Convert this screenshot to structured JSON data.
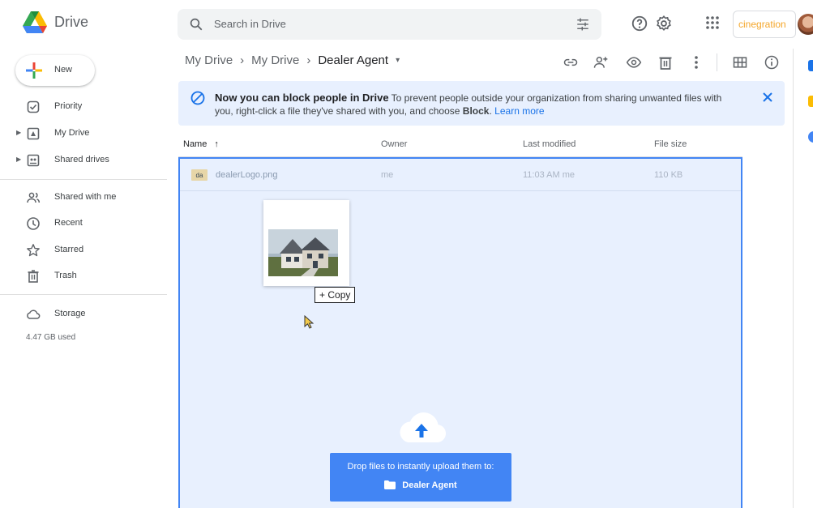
{
  "app": {
    "name": "Drive"
  },
  "search": {
    "placeholder": "Search in Drive"
  },
  "header": {
    "brand": "cinegration"
  },
  "sidebar": {
    "new_label": "New",
    "items": [
      {
        "label": "Priority",
        "icon": "priority-icon"
      },
      {
        "label": "My Drive",
        "icon": "my-drive-icon"
      },
      {
        "label": "Shared drives",
        "icon": "shared-drives-icon"
      },
      {
        "label": "Shared with me",
        "icon": "shared-with-me-icon"
      },
      {
        "label": "Recent",
        "icon": "clock-icon"
      },
      {
        "label": "Starred",
        "icon": "star-icon"
      },
      {
        "label": "Trash",
        "icon": "trash-icon"
      },
      {
        "label": "Storage",
        "icon": "cloud-icon"
      }
    ],
    "storage_used": "4.47 GB used"
  },
  "breadcrumb": {
    "items": [
      "My Drive",
      "My Drive",
      "Dealer Agent"
    ]
  },
  "banner": {
    "heading": "Now you can block people in Drive",
    "text1": "To prevent people outside your organization from sharing unwanted files with you, right-click a file they've shared with you, and choose",
    "bold": "Block",
    "text2": ".",
    "link": "Learn more"
  },
  "columns": {
    "name": "Name",
    "owner": "Owner",
    "modified": "Last modified",
    "size": "File size"
  },
  "files": [
    {
      "name": "dealerLogo.png",
      "owner": "me",
      "modified": "11:03 AM me",
      "size": "110 KB"
    }
  ],
  "drag": {
    "copy_label": "Copy"
  },
  "upload": {
    "line1": "Drop files to instantly upload them to:",
    "folder": "Dealer Agent"
  },
  "colors": {
    "accent": "#1a73e8",
    "drop_bg": "#e8f0fe",
    "drop_border": "#4285f4"
  }
}
